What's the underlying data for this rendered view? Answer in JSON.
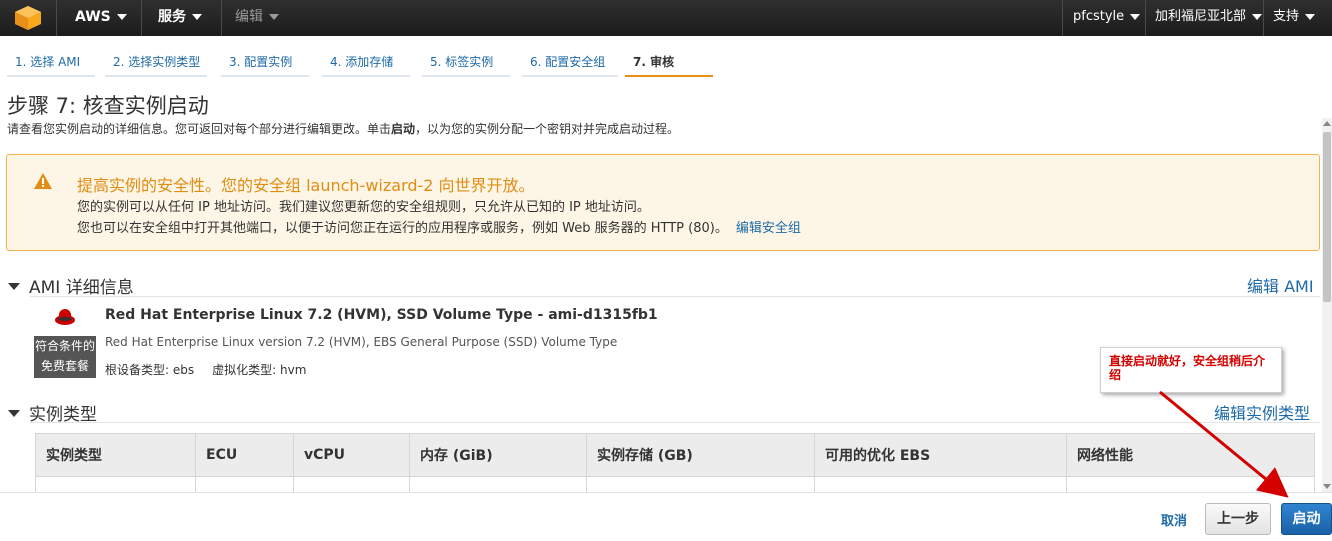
{
  "topnav": {
    "brand": "AWS",
    "services": "服务",
    "edit": "编辑",
    "user": "pfcstyle",
    "region": "加利福尼亚北部",
    "support": "支持"
  },
  "steps": [
    "1. 选择 AMI",
    "2. 选择实例类型",
    "3. 配置实例",
    "4. 添加存储",
    "5. 标签实例",
    "6. 配置安全组",
    "7. 审核"
  ],
  "page": {
    "title": "步骤 7: 核查实例启动",
    "desc_before": "请查看您实例启动的详细信息。您可返回对每个部分进行编辑更改。单击",
    "desc_bold": "启动",
    "desc_after": "，以为您的实例分配一个密钥对并完成启动过程。"
  },
  "warning": {
    "title": "提高实例的安全性。您的安全组 launch-wizard-2 向世界开放。",
    "line1": "您的实例可以从任何 IP 地址访问。我们建议您更新您的安全组规则，只允许从已知的 IP 地址访问。",
    "line2": "您也可以在安全组中打开其他端口，以便于访问您正在运行的应用程序或服务，例如 Web 服务器的 HTTP (80)。",
    "link": "编辑安全组"
  },
  "ami": {
    "heading": "AMI 详细信息",
    "edit": "编辑 AMI",
    "free_badge_line1": "符合条件的",
    "free_badge_line2": "免费套餐",
    "name": "Red Hat Enterprise Linux 7.2 (HVM), SSD Volume Type - ami-d1315fb1",
    "desc": "Red Hat Enterprise Linux version 7.2 (HVM), EBS General Purpose (SSD) Volume Type",
    "root_device": "根设备类型: ebs",
    "virtualization": "虚拟化类型: hvm"
  },
  "instance": {
    "heading": "实例类型",
    "edit": "编辑实例类型",
    "columns": [
      "实例类型",
      "ECU",
      "vCPU",
      "内存 (GiB)",
      "实例存储 (GB)",
      "可用的优化 EBS",
      "网络性能"
    ]
  },
  "footer": {
    "cancel": "取消",
    "previous": "上一步",
    "launch": "启动"
  },
  "annotation": {
    "text": "直接启动就好，安全组稍后介绍"
  },
  "colors": {
    "link": "#1e6aa8",
    "warning_orange": "#e28c13",
    "launch_blue": "#1f6cb5",
    "annotation_red": "#d40000"
  }
}
